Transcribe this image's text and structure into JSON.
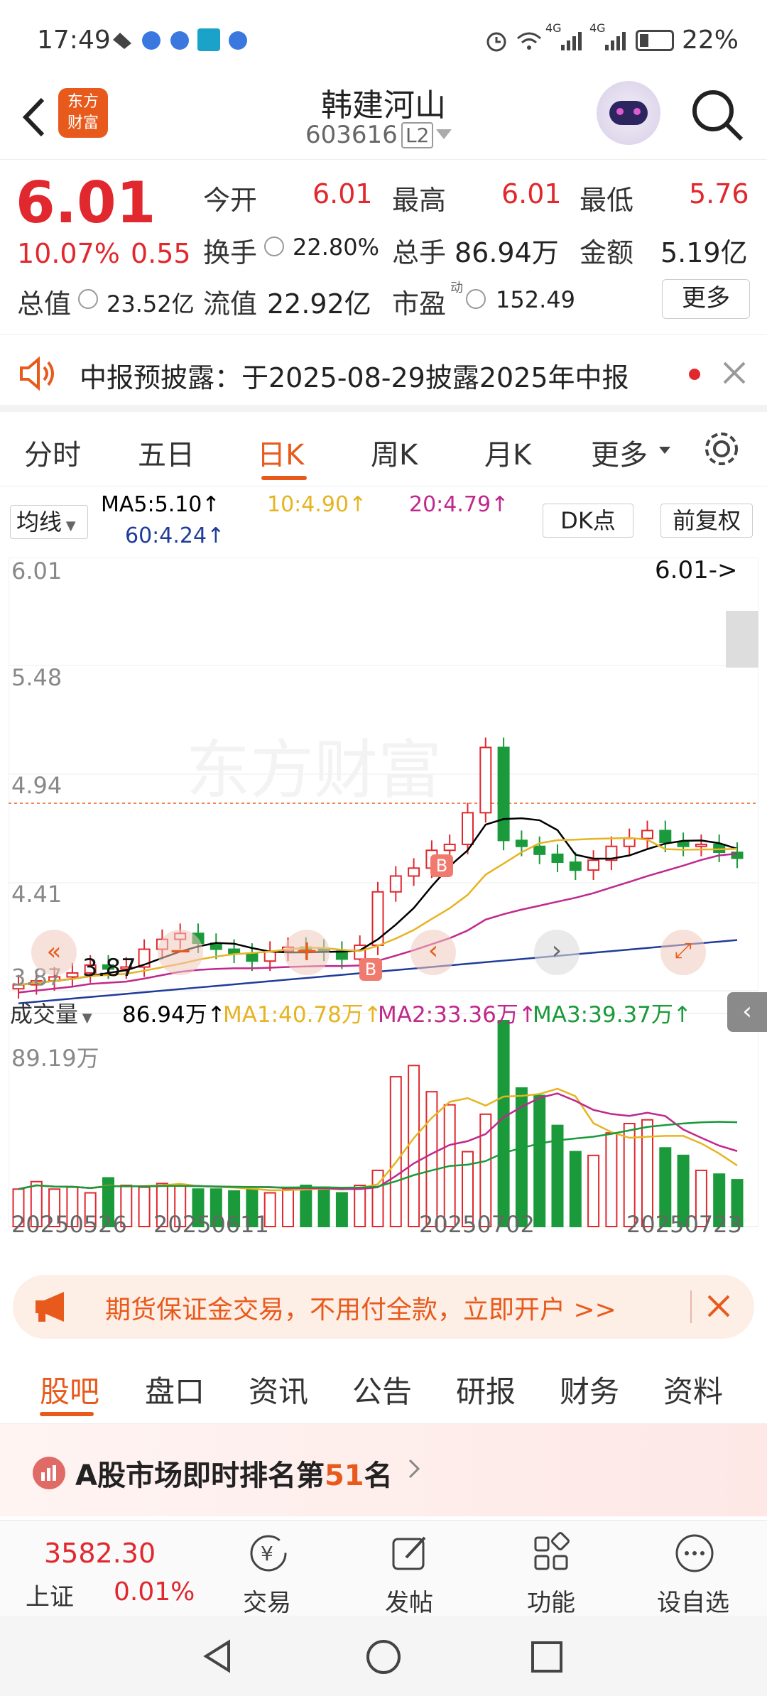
{
  "status": {
    "time": "17:49",
    "battery": "22%",
    "network1": "4G",
    "network2": "4G"
  },
  "header": {
    "logo_line1": "东方",
    "logo_line2": "财富",
    "stock_name": "韩建河山",
    "stock_code": "603616",
    "level_badge": "L2"
  },
  "quote": {
    "price": "6.01",
    "change_pct": "10.07%",
    "change": "0.55",
    "rows": [
      [
        {
          "label": "今开",
          "value": "6.01",
          "color": "red"
        },
        {
          "label": "最高",
          "value": "6.01",
          "color": "red"
        },
        {
          "label": "最低",
          "value": "5.76",
          "color": "red"
        }
      ],
      [
        {
          "label": "换手",
          "value": "22.80%",
          "color": "black"
        },
        {
          "label": "总手",
          "value": "86.94万",
          "color": "black"
        },
        {
          "label": "金额",
          "value": "5.19亿",
          "color": "black"
        }
      ],
      [
        {
          "label": "总值",
          "value": "23.52亿",
          "color": "black"
        },
        {
          "label": "流值",
          "value": "22.92亿",
          "color": "black"
        },
        {
          "label": "市盈",
          "value": "152.49",
          "color": "black"
        }
      ]
    ],
    "pe_superscript": "动",
    "more_button": "更多"
  },
  "notice": {
    "text": "中报预披露：于2025-08-29披露2025年中报"
  },
  "tabs": [
    "分时",
    "五日",
    "日K",
    "周K",
    "月K",
    "更多"
  ],
  "active_tab": "日K",
  "ma_bar": {
    "selector": "均线",
    "ma5": "MA5:5.10↑",
    "ma10": "10:4.90↑",
    "ma20": "20:4.79↑",
    "ma60": "60:4.24↑",
    "dk_button": "DK点",
    "fq_button": "前复权"
  },
  "kline": {
    "y_labels": [
      "6.01",
      "5.48",
      "4.94",
      "4.41",
      "3.87"
    ],
    "last_price_tag": "6.01->",
    "low_tag": "3.87",
    "watermark": "东方财富",
    "b_marker": "B"
  },
  "volume_bar": {
    "selector": "成交量",
    "vol": "86.94万↑",
    "ma1": "MA1:40.78万↑",
    "ma2": "MA2:33.36万↑",
    "ma3": "MA3:39.37万↑",
    "top_label": "89.19万"
  },
  "dates": [
    "20250526",
    "20250611",
    "20250702",
    "20250723"
  ],
  "ad": {
    "text": "期货保证金交易，不用付全款，立即开户 >>"
  },
  "subtabs": [
    "股吧",
    "盘口",
    "资讯",
    "公告",
    "研报",
    "财务",
    "资料"
  ],
  "active_subtab": "股吧",
  "rank": {
    "prefix": "A股市场即时排名第",
    "number": "51",
    "suffix": "名"
  },
  "bottom_nav": {
    "index_value": "3582.30",
    "index_name": "上证",
    "index_change": "0.01%",
    "items": [
      "交易",
      "发帖",
      "功能",
      "设自选"
    ]
  },
  "colors": {
    "up": "#e0282e",
    "down": "#1a9a3a",
    "ma5": "#000000",
    "ma10": "#e6b422",
    "ma20": "#c0288c",
    "ma60": "#1f3c9a",
    "accent": "#e85a1c"
  }
}
